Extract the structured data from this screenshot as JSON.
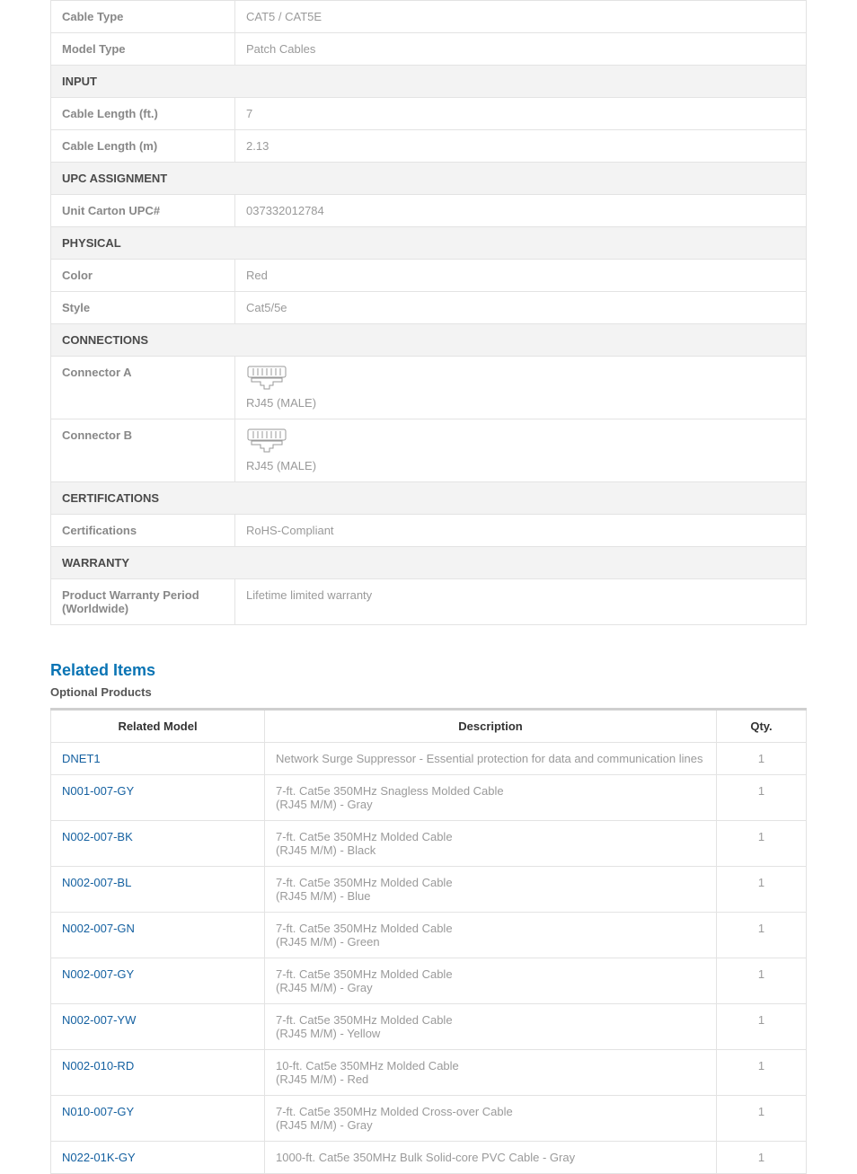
{
  "specs": {
    "cable_type": {
      "label": "Cable Type",
      "value": "CAT5 / CAT5E"
    },
    "model_type": {
      "label": "Model Type",
      "value": "Patch Cables"
    },
    "input_header": "INPUT",
    "cable_len_ft": {
      "label": "Cable Length (ft.)",
      "value": "7"
    },
    "cable_len_m": {
      "label": "Cable Length (m)",
      "value": "2.13"
    },
    "upc_header": "UPC ASSIGNMENT",
    "unit_upc": {
      "label": "Unit Carton UPC#",
      "value": "037332012784"
    },
    "physical_header": "PHYSICAL",
    "color": {
      "label": "Color",
      "value": "Red"
    },
    "style": {
      "label": "Style",
      "value": "Cat5/5e"
    },
    "connections_header": "CONNECTIONS",
    "connector_a": {
      "label": "Connector A",
      "value": "RJ45 (MALE)"
    },
    "connector_b": {
      "label": "Connector B",
      "value": "RJ45 (MALE)"
    },
    "cert_header": "CERTIFICATIONS",
    "certifications": {
      "label": "Certifications",
      "value": "RoHS-Compliant"
    },
    "warranty_header": "WARRANTY",
    "warranty": {
      "label": "Product Warranty Period (Worldwide)",
      "value": "Lifetime limited warranty"
    }
  },
  "related": {
    "heading": "Related Items",
    "subheading": "Optional Products",
    "col_model": "Related Model",
    "col_desc": "Description",
    "col_qty": "Qty.",
    "rows": [
      {
        "model": "DNET1",
        "desc": "Network Surge Suppressor - Essential protection for data and communication lines",
        "qty": "1"
      },
      {
        "model": "N001-007-GY",
        "desc": "7-ft. Cat5e 350MHz Snagless Molded Cable\n(RJ45 M/M) - Gray",
        "qty": "1"
      },
      {
        "model": "N002-007-BK",
        "desc": "7-ft. Cat5e 350MHz Molded Cable\n(RJ45 M/M) - Black",
        "qty": "1"
      },
      {
        "model": "N002-007-BL",
        "desc": "7-ft. Cat5e 350MHz Molded Cable\n(RJ45 M/M) - Blue",
        "qty": "1"
      },
      {
        "model": "N002-007-GN",
        "desc": "7-ft. Cat5e 350MHz Molded Cable\n(RJ45 M/M) - Green",
        "qty": "1"
      },
      {
        "model": "N002-007-GY",
        "desc": "7-ft. Cat5e 350MHz Molded Cable\n(RJ45 M/M) - Gray",
        "qty": "1"
      },
      {
        "model": "N002-007-YW",
        "desc": "7-ft. Cat5e 350MHz Molded Cable\n(RJ45 M/M) - Yellow",
        "qty": "1"
      },
      {
        "model": "N002-010-RD",
        "desc": "10-ft. Cat5e 350MHz Molded Cable\n(RJ45 M/M) - Red",
        "qty": "1"
      },
      {
        "model": "N010-007-GY",
        "desc": "7-ft. Cat5e 350MHz Molded Cross-over Cable\n(RJ45 M/M) - Gray",
        "qty": "1"
      },
      {
        "model": "N022-01K-GY",
        "desc": "1000-ft. Cat5e 350MHz Bulk Solid-core PVC Cable - Gray",
        "qty": "1"
      }
    ]
  }
}
